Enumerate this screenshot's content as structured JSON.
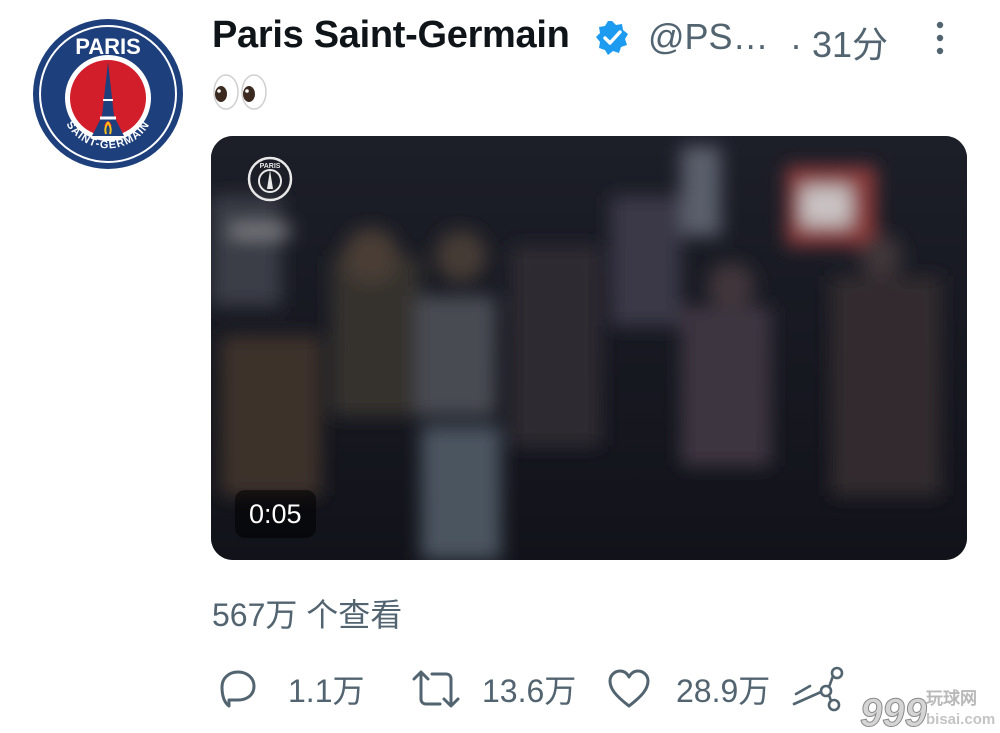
{
  "tweet": {
    "author_name": "Paris Saint-Germain",
    "handle": "@PS…",
    "time": "· 31分",
    "text_emoji": "eyes"
  },
  "video": {
    "duration": "0:05",
    "views": "567万 个查看"
  },
  "actions": {
    "reply_count": "1.1万",
    "retweet_count": "13.6万",
    "like_count": "28.9万"
  },
  "avatar": {
    "logo_top": "PARIS",
    "logo_bottom": "SAINT-GERMAIN"
  },
  "watermark": {
    "number": "999",
    "cn": "玩球网",
    "domain": "bisai.com"
  },
  "colors": {
    "text_primary": "#0f1419",
    "text_secondary": "#536471",
    "verified_blue": "#1d9bf0",
    "psg_navy": "#1d3f7c",
    "psg_red": "#d21e2b"
  }
}
